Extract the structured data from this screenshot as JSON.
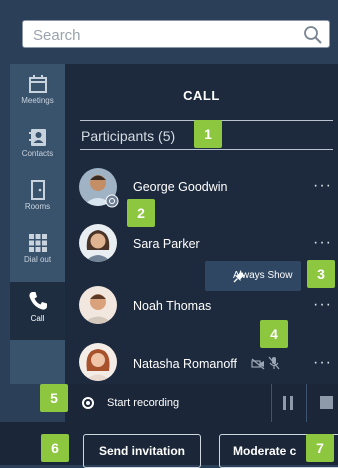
{
  "search": {
    "placeholder": "Search"
  },
  "sidebar": {
    "items": [
      {
        "label": "Meetings",
        "icon": "calendar-icon"
      },
      {
        "label": "Contacts",
        "icon": "contacts-icon"
      },
      {
        "label": "Rooms",
        "icon": "door-icon"
      },
      {
        "label": "Dial out",
        "icon": "dialpad-icon"
      },
      {
        "label": "Call",
        "icon": "phone-icon",
        "active": true
      }
    ]
  },
  "panel": {
    "title": "CALL",
    "participants_header": "Participants (5)",
    "participants": [
      {
        "name": "George Goodwin",
        "status_icon": "connecting-icon"
      },
      {
        "name": "Sara Parker"
      },
      {
        "name": "Noah Thomas"
      },
      {
        "name": "Natasha Romanoff",
        "icons": [
          "video-off-icon",
          "mic-off-icon"
        ]
      }
    ],
    "more_label": "···",
    "tooltip": "Always Show"
  },
  "recording": {
    "label": "Start recording"
  },
  "actions": {
    "send_invitation": "Send invitation",
    "moderate": "Moderate c"
  },
  "callouts": [
    "1",
    "2",
    "3",
    "4",
    "5",
    "6",
    "7"
  ],
  "colors": {
    "callout_green": "#8dc63f",
    "panel_bg": "#1d2a3d",
    "sidebar_bg": "#3a536d"
  }
}
